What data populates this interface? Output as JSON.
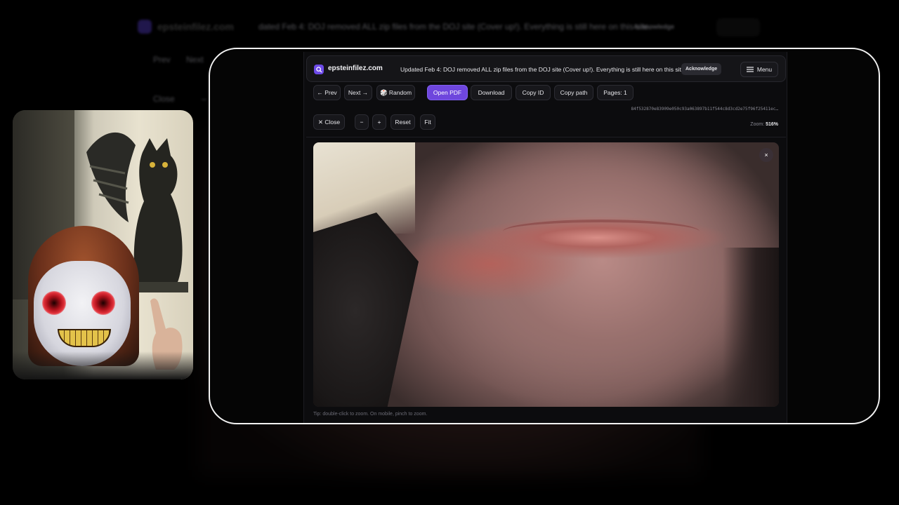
{
  "background": {
    "site_name": "epsteinfilez.com",
    "notice": "dated Feb 4: DOJ removed ALL zip files from the DOJ site (Cover up!). Everything is still here on this site.",
    "ack": "Acknowledge",
    "prev": "Prev",
    "next": "Next",
    "close": "Close",
    "dash": "–"
  },
  "header": {
    "site_name": "epsteinfilez.com",
    "notice": "Updated Feb 4: DOJ removed ALL zip files from the DOJ site (Cover up!). Everything is still here on this site.",
    "ack_label": "Acknowledge",
    "menu_label": "Menu",
    "logo_icon": "search-icon",
    "menu_icon": "hamburger-icon"
  },
  "toolbar": {
    "prev": "← Prev",
    "next": "Next →",
    "random": "🎲 Random",
    "open_pdf": "Open PDF",
    "download": "Download",
    "copy_id": "Copy ID",
    "copy_path": "Copy path",
    "pages": "Pages: 1",
    "hash": "84f532870e83909e050c93a063897b11f544c8d3cd2e75f96f25411ec…"
  },
  "zoombar": {
    "close": "✕ Close",
    "zoom_out": "−",
    "zoom_in": "+",
    "reset": "Reset",
    "fit": "Fit",
    "zoom_label": "Zoom:",
    "zoom_value": "516%"
  },
  "viewer": {
    "close_symbol": "×",
    "tip": "Tip: double-click to zoom. On mobile, pinch to zoom."
  },
  "colors": {
    "accent": "#6e46dd",
    "window_border": "#f2f2f2"
  }
}
